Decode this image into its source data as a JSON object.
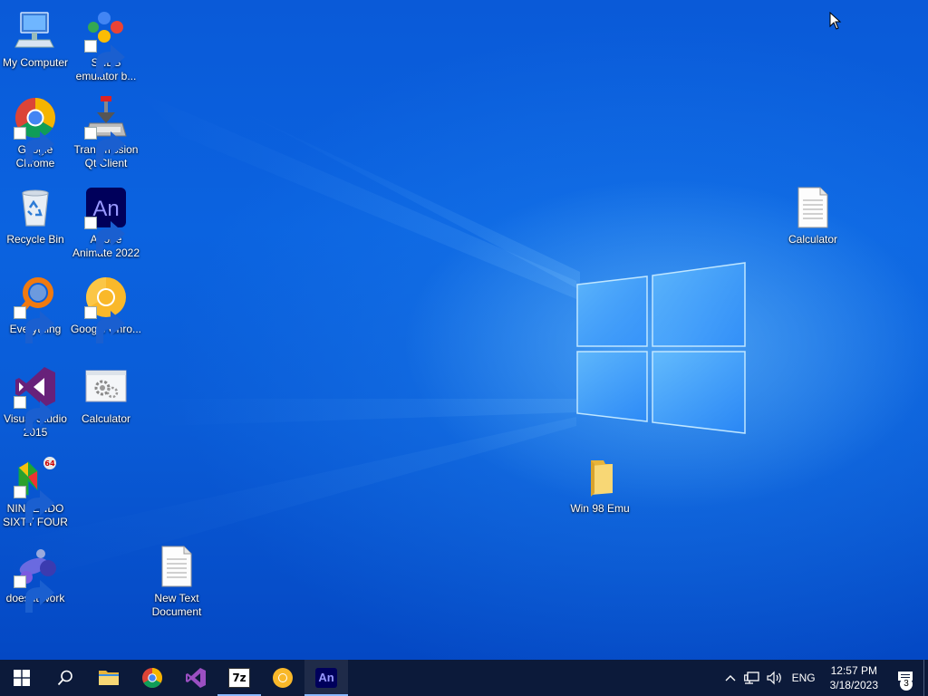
{
  "desktop": {
    "icons": [
      {
        "label": "My Computer"
      },
      {
        "label": "SNES emulator b..."
      },
      {
        "label": "Google Chrome"
      },
      {
        "label": "Transmission Qt Client"
      },
      {
        "label": "Recycle Bin"
      },
      {
        "label": "Adobe Animate 2022"
      },
      {
        "label": "Everything"
      },
      {
        "label": "Google Chro..."
      },
      {
        "label": "Visual Studio 2015"
      },
      {
        "label": "Calculator"
      },
      {
        "label": "NINTENDO SIXTY FOUR"
      },
      {
        "label": "doesnt work"
      },
      {
        "label": "New Text Document"
      },
      {
        "label": "Calculator"
      },
      {
        "label": "Win 98 Emu"
      }
    ],
    "app_icon_text": {
      "animate": "An",
      "sevenzip": "7z",
      "n64_badge": "64"
    }
  },
  "taskbar": {
    "items": [
      {
        "name": "start",
        "icon": "windows-logo-icon"
      },
      {
        "name": "search",
        "icon": "search-icon"
      },
      {
        "name": "file-explorer",
        "icon": "folder-icon"
      },
      {
        "name": "chrome",
        "icon": "chrome-icon"
      },
      {
        "name": "visual-studio",
        "icon": "visual-studio-icon"
      },
      {
        "name": "7zip",
        "icon": "7zip-icon",
        "label": "7z"
      },
      {
        "name": "chrome-canary",
        "icon": "chrome-canary-icon"
      },
      {
        "name": "animate",
        "icon": "animate-icon",
        "label": "An"
      }
    ],
    "tray": {
      "language": "ENG",
      "time": "12:57 PM",
      "date": "3/18/2023",
      "notification_count": "3"
    }
  },
  "colors": {
    "taskbar_bg": "#0c1a3a",
    "wallpaper": "#0a5ad8",
    "accent": "#7fb3ff"
  }
}
